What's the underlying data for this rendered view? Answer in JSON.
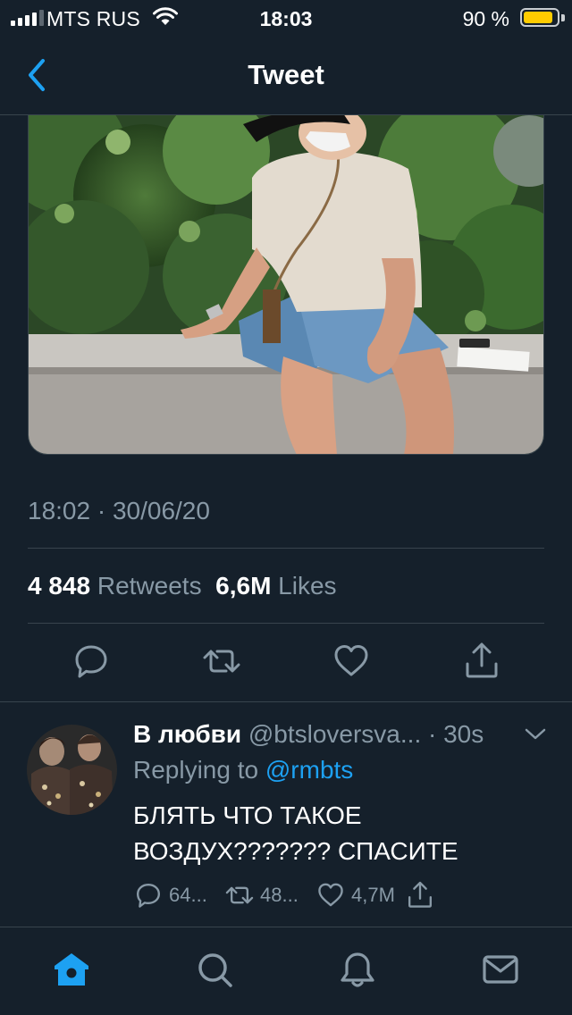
{
  "status_bar": {
    "carrier": "MTS RUS",
    "time": "18:03",
    "battery_percent": "90 %",
    "battery_level": 0.9,
    "battery_color": "#ffcc00"
  },
  "nav": {
    "title": "Tweet",
    "back_icon": "chevron-left-icon"
  },
  "tweet": {
    "timestamp": "18:02 · 30/06/20",
    "retweets_count": "4 848",
    "retweets_label": "Retweets",
    "likes_count": "6,6M",
    "likes_label": "Likes",
    "actions": [
      "reply-icon",
      "retweet-icon",
      "like-icon",
      "share-icon"
    ]
  },
  "reply": {
    "name": "В любви",
    "handle": "@btsloversva...",
    "time": "· 30s",
    "replying_prefix": "Replying to",
    "replying_handle": "@rmbts",
    "text_line1": "БЛЯТЬ ЧТО ТАКОЕ",
    "text_line2": "ВОЗДУХ??????? СПАСИТЕ",
    "reply_count": "64...",
    "retweet_count": "48...",
    "like_count": "4,7M"
  },
  "tab_bar": {
    "tabs": [
      "home-icon",
      "search-icon",
      "notifications-icon",
      "messages-icon"
    ],
    "active": "home-icon"
  },
  "colors": {
    "background": "#15202b",
    "accent": "#1da1f2",
    "secondary_text": "#8899a6",
    "divider": "#38444d"
  }
}
